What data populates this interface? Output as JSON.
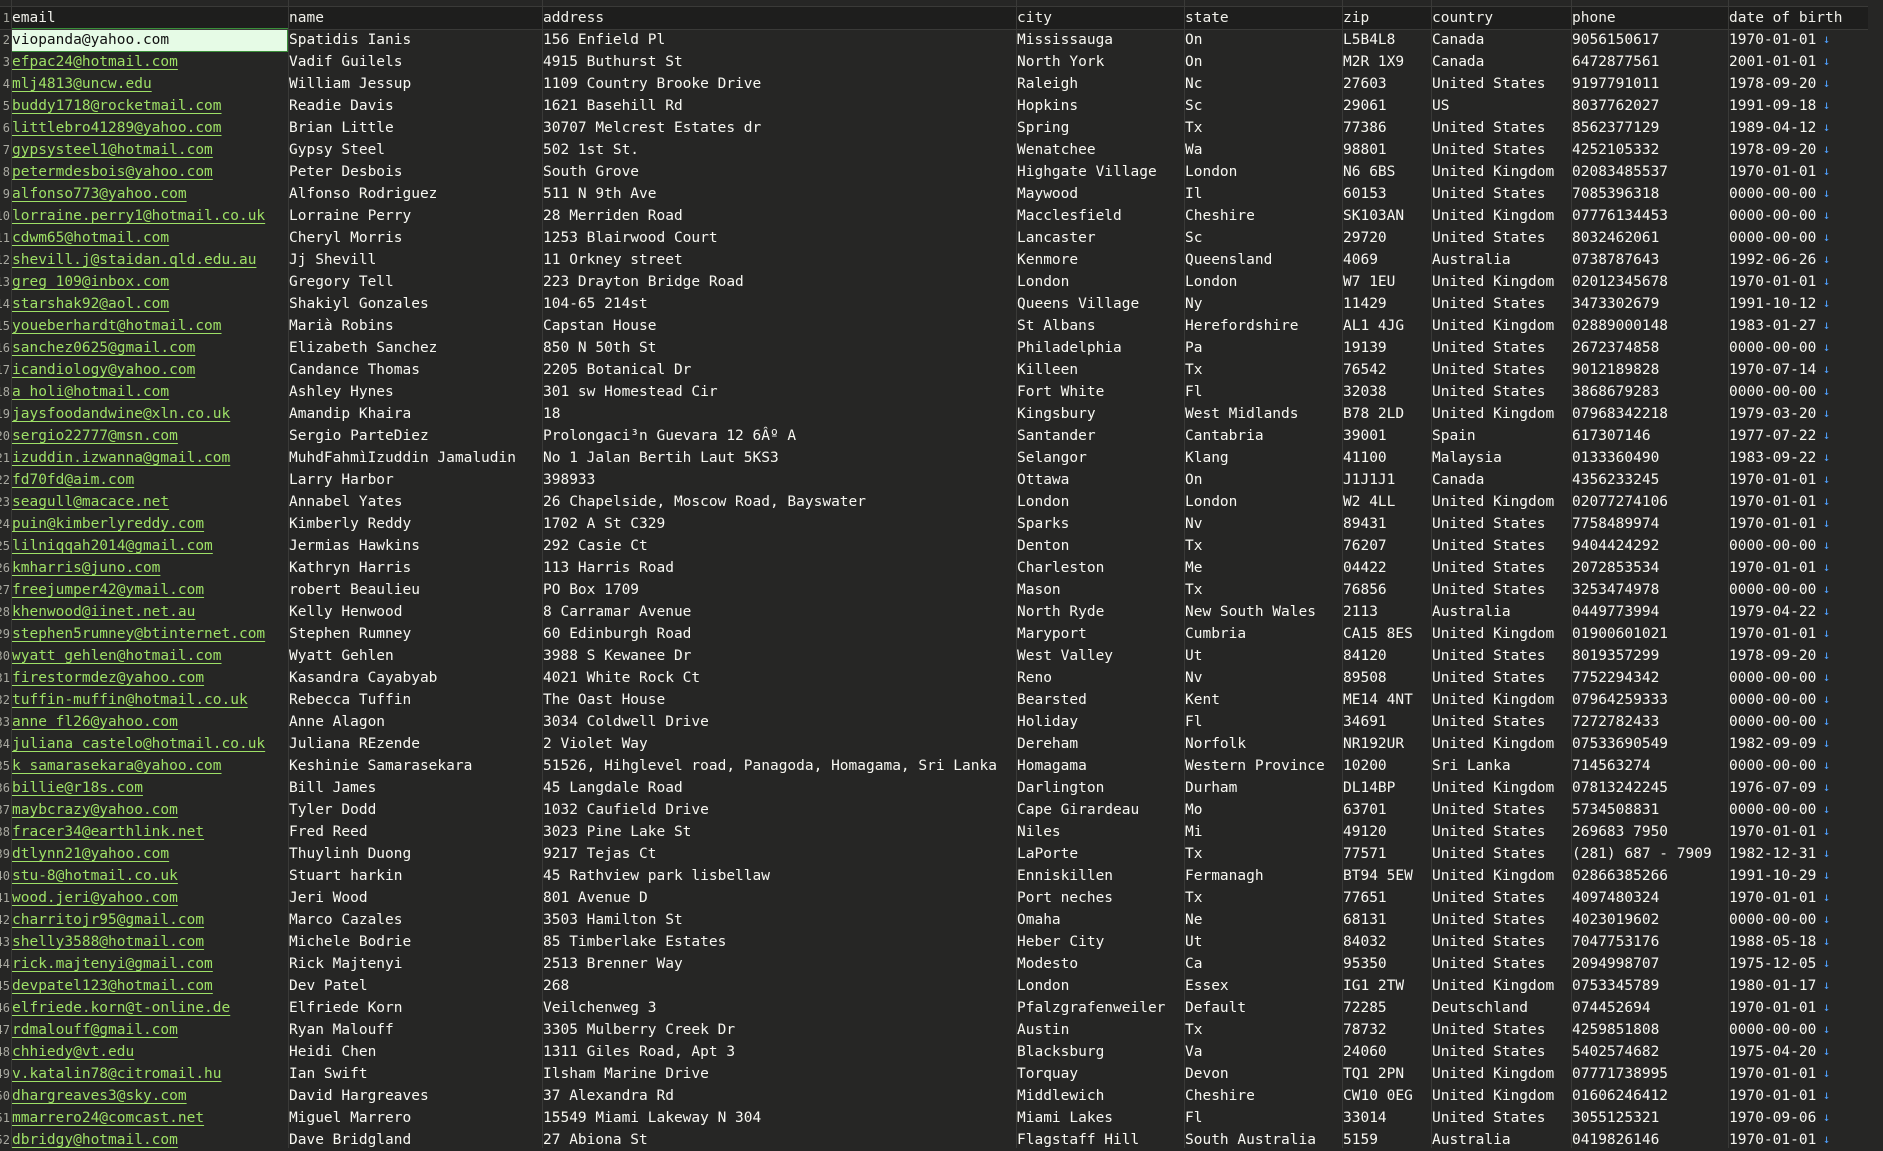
{
  "headers": [
    "email",
    "name",
    "address",
    "city",
    "state",
    "zip",
    "country",
    "phone",
    "date of birth"
  ],
  "rows": [
    [
      "viopanda@yahoo.com",
      "Spatidis Ianis",
      "156  Enfield Pl",
      "Mississauga",
      "On",
      "L5B4L8",
      "Canada",
      "9056150617",
      "1970-01-01"
    ],
    [
      "efpac24@hotmail.com",
      "Vadif Guilels",
      "4915 Buthurst St",
      "North York",
      "On",
      "M2R 1X9",
      "Canada",
      "6472877561",
      "2001-01-01"
    ],
    [
      "mlj4813@uncw.edu",
      "William Jessup",
      "1109 Country Brooke Drive",
      "Raleigh",
      "Nc",
      "27603",
      "United States",
      "9197791011",
      "1978-09-20"
    ],
    [
      "buddy1718@rocketmail.com",
      "Readie Davis",
      "1621 Basehill Rd",
      "Hopkins",
      "Sc",
      "29061",
      "US",
      "8037762027",
      "1991-09-18"
    ],
    [
      "littlebro41289@yahoo.com",
      "Brian Little",
      "30707 Melcrest Estates dr",
      "Spring",
      "Tx",
      "77386",
      "United States",
      "8562377129",
      "1989-04-12"
    ],
    [
      "gypsysteel1@hotmail.com",
      "Gypsy Steel",
      "502 1st St.",
      "Wenatchee",
      "Wa",
      "98801",
      "United States",
      "4252105332",
      "1978-09-20"
    ],
    [
      "petermdesbois@yahoo.com",
      "Peter Desbois",
      "South Grove",
      "Highgate Village",
      "London",
      "N6 6BS",
      "United Kingdom",
      "02083485537",
      "1970-01-01"
    ],
    [
      "alfonso773@yahoo.com",
      "Alfonso Rodriguez",
      "511 N 9th Ave",
      "Maywood",
      "Il",
      "60153",
      "United States",
      "7085396318",
      "0000-00-00"
    ],
    [
      "lorraine.perry1@hotmail.co.uk",
      "Lorraine Perry",
      "28 Merriden Road",
      "Macclesfield",
      "Cheshire",
      "SK103AN",
      "United Kingdom",
      "07776134453",
      "0000-00-00"
    ],
    [
      "cdwm65@hotmail.com",
      "Cheryl Morris",
      "1253 Blairwood Court",
      "Lancaster",
      "Sc",
      "29720",
      "United States",
      "8032462061",
      "0000-00-00"
    ],
    [
      "shevill.j@staidan.qld.edu.au",
      "Jj Shevill",
      "11 Orkney street",
      "Kenmore",
      "Queensland",
      "4069",
      "Australia",
      "0738787643",
      "1992-06-26"
    ],
    [
      "greg_109@inbox.com",
      "Gregory Tell",
      "223  Drayton Bridge Road",
      "London",
      "London",
      "W7 1EU",
      "United Kingdom",
      "02012345678",
      "1970-01-01"
    ],
    [
      "starshak92@aol.com",
      "Shakiyl Gonzales",
      "104-65 214st",
      "Queens Village",
      "Ny",
      "11429",
      "United States",
      "3473302679",
      "1991-10-12"
    ],
    [
      "youeberhardt@hotmail.com",
      "Marià Robins",
      "Capstan House",
      "St Albans",
      "Herefordshire",
      "AL1 4JG",
      "United Kingdom",
      "02889000148",
      "1983-01-27"
    ],
    [
      "sanchez0625@gmail.com",
      "Elizabeth Sanchez",
      "850 N 50th St",
      "Philadelphia",
      "Pa",
      "19139",
      "United States",
      "2672374858",
      "0000-00-00"
    ],
    [
      "icandiology@yahoo.com",
      "Candance Thomas",
      "2205 Botanical Dr",
      "Killeen",
      "Tx",
      "76542",
      "United States",
      "9012189828",
      "1970-07-14"
    ],
    [
      "a_holi@hotmail.com",
      "Ashley Hynes",
      "301 sw Homestead Cir",
      "Fort White",
      "Fl",
      "32038",
      "United States",
      "3868679283",
      "0000-00-00"
    ],
    [
      "jaysfoodandwine@xln.co.uk",
      "Amandip Khaira",
      "18",
      "Kingsbury",
      "West Midlands",
      "B78 2LD",
      "United Kingdom",
      "07968342218",
      "1979-03-20"
    ],
    [
      "sergio22777@msn.com",
      "Sergio ParteDiez",
      "Prolongaci³n Guevara 12 6Âº A",
      "Santander",
      "Cantabria",
      "39001",
      "Spain",
      "617307146",
      "1977-07-22"
    ],
    [
      "izuddin.izwanna@gmail.com",
      "MuhdFahmìIzuddin Jamaludin",
      "No 1 Jalan Bertih Laut 5KS3",
      "Selangor",
      "Klang",
      "41100",
      "Malaysia",
      "0133360490",
      "1983-09-22"
    ],
    [
      "fd70fd@aim.com",
      "Larry Harbor",
      "398933",
      "Ottawa",
      "On",
      "J1J1J1",
      "Canada",
      "4356233245",
      "1970-01-01"
    ],
    [
      "seagull@macace.net",
      "Annabel Yates",
      "26 Chapelside, Moscow Road, Bayswater",
      "London",
      "London",
      "W2 4LL",
      "United Kingdom",
      "02077274106",
      "1970-01-01"
    ],
    [
      "puin@kimberlyreddy.com",
      "Kimberly Reddy",
      "1702 A St C329",
      "Sparks",
      "Nv",
      "89431",
      "United States",
      "7758489974",
      "1970-01-01"
    ],
    [
      "lilniqqah2014@gmail.com",
      "Jermias Hawkins",
      "292 Casie Ct",
      "Denton",
      "Tx",
      "76207",
      "United States",
      "9404424292",
      "0000-00-00"
    ],
    [
      "kmharris@juno.com",
      "Kathryn Harris",
      "113 Harris Road",
      "Charleston",
      "Me",
      "04422",
      "United States",
      "2072853534",
      "1970-01-01"
    ],
    [
      "freejumper42@ymail.com",
      "robert Beaulieu",
      "PO Box 1709",
      "Mason",
      "Tx",
      "76856",
      "United States",
      "3253474978",
      "0000-00-00"
    ],
    [
      "khenwood@iinet.net.au",
      "Kelly Henwood",
      "8 Carramar Avenue",
      "North Ryde",
      "New South Wales",
      "2113",
      "Australia",
      "0449773994",
      "1979-04-22"
    ],
    [
      "stephen5rumney@btinternet.com",
      "Stephen Rumney",
      "60 Edinburgh Road",
      "Maryport",
      "Cumbria",
      "CA15 8ES",
      "United Kingdom",
      "01900601021",
      "1970-01-01"
    ],
    [
      "wyatt_gehlen@hotmail.com",
      "Wyatt Gehlen",
      "3988 S Kewanee Dr",
      "West Valley",
      "Ut",
      "84120",
      "United States",
      "8019357299",
      "1978-09-20"
    ],
    [
      "firestormdez@yahoo.com",
      "Kasandra Cayabyab",
      "4021 White Rock Ct",
      "Reno",
      "Nv",
      "89508",
      "United States",
      "7752294342",
      "0000-00-00"
    ],
    [
      "tuffin-muffin@hotmail.co.uk",
      "Rebecca Tuffin",
      "The Oast House",
      "Bearsted",
      "Kent",
      "ME14 4NT",
      "United Kingdom",
      "07964259333",
      "0000-00-00"
    ],
    [
      "anne_fl26@yahoo.com",
      "Anne Alagon",
      "3034 Coldwell Drive",
      "Holiday",
      "Fl",
      "34691",
      "United States",
      "7272782433",
      "0000-00-00"
    ],
    [
      "juliana_castelo@hotmail.co.uk",
      "Juliana REzende",
      "2 Violet Way",
      "Dereham",
      "Norfolk",
      "NR192UR",
      "United Kingdom",
      "07533690549",
      "1982-09-09"
    ],
    [
      "k_samarasekara@yahoo.com",
      "Keshinie Samarasekara",
      "51526, Hihglevel road, Panagoda, Homagama, Sri Lanka",
      "Homagama",
      "Western Province",
      "10200",
      "Sri Lanka",
      "714563274",
      "0000-00-00"
    ],
    [
      "billie@r18s.com",
      "Bill James",
      "45 Langdale Road",
      "Darlington",
      "Durham",
      "DL14BP",
      "United Kingdom",
      "07813242245",
      "1976-07-09"
    ],
    [
      "maybcrazy@yahoo.com",
      "Tyler Dodd",
      "1032 Caufield Drive",
      "Cape Girardeau",
      "Mo",
      "63701",
      "United States",
      "5734508831",
      "0000-00-00"
    ],
    [
      "fracer34@earthlink.net",
      "Fred Reed",
      "3023 Pine Lake St",
      "Niles",
      "Mi",
      "49120",
      "United States",
      "269683 7950",
      "1970-01-01"
    ],
    [
      "dtlynn21@yahoo.com",
      "Thuylinh Duong",
      "9217 Tejas Ct",
      "LaPorte",
      "Tx",
      "77571",
      "United States",
      "(281) 687 - 7909",
      "1982-12-31"
    ],
    [
      "stu-8@hotmail.co.uk",
      "Stuart harkin",
      "45 Rathview park lisbellaw",
      "Enniskillen",
      "Fermanagh",
      "BT94 5EW",
      "United Kingdom",
      "02866385266",
      "1991-10-29"
    ],
    [
      "wood.jeri@yahoo.com",
      "Jeri Wood",
      "801 Avenue D",
      "Port neches",
      "Tx",
      "77651",
      "United States",
      "4097480324",
      "1970-01-01"
    ],
    [
      "charritojr95@gmail.com",
      "Marco Cazales",
      "3503 Hamilton St",
      "Omaha",
      "Ne",
      "68131",
      "United States",
      "4023019602",
      "0000-00-00"
    ],
    [
      "shelly3588@hotmail.com",
      "Michele Bodrie",
      "85 Timberlake Estates",
      "Heber City",
      "Ut",
      "84032",
      "United States",
      "7047753176",
      "1988-05-18"
    ],
    [
      "rick.majtenyi@gmail.com",
      "Rick Majtenyi",
      "2513 Brenner Way",
      "Modesto",
      "Ca",
      "95350",
      "United States",
      "2094998707",
      "1975-12-05"
    ],
    [
      "devpatel123@hotmail.com",
      "Dev Patel",
      "268",
      "London",
      "Essex",
      "IG1 2TW",
      "United Kingdom",
      "0753345789",
      "1980-01-17"
    ],
    [
      "elfriede.korn@t-online.de",
      "Elfriede Korn",
      "Veilchenweg 3",
      "Pfalzgrafenweiler",
      "Default",
      "72285",
      "Deutschland",
      "074452694",
      "1970-01-01"
    ],
    [
      "rdmalouff@gmail.com",
      "Ryan Malouff",
      "3305 Mulberry Creek Dr",
      "Austin",
      "Tx",
      "78732",
      "United States",
      "4259851808",
      "0000-00-00"
    ],
    [
      "chhiedy@vt.edu",
      "Heidi Chen",
      "1311 Giles Road, Apt 3",
      "Blacksburg",
      "Va",
      "24060",
      "United States",
      "5402574682",
      "1975-04-20"
    ],
    [
      "v.katalin78@citromail.hu",
      "Ian Swift",
      "Ilsham Marine Drive",
      "Torquay",
      "Devon",
      "TQ1 2PN",
      "United Kingdom",
      "07771738995",
      "1970-01-01"
    ],
    [
      "dhargreaves3@sky.com",
      "David Hargreaves",
      "37 Alexandra Rd",
      "Middlewich",
      "Cheshire",
      "CW10 0EG",
      "United Kingdom",
      "01606246412",
      "1970-01-01"
    ],
    [
      "mmarrero24@comcast.net",
      "Miguel Marrero",
      "15549 Miami Lakeway N  304",
      "Miami Lakes",
      "Fl",
      "33014",
      "United States",
      "3055125321",
      "1970-09-06"
    ],
    [
      "dbridgy@hotmail.com",
      "Dave Bridgland",
      "27 Abiona St",
      "Flagstaff Hill",
      "South Australia",
      "5159",
      "Australia",
      "0419826146",
      "1970-01-01"
    ]
  ],
  "dob_marker": "↓"
}
